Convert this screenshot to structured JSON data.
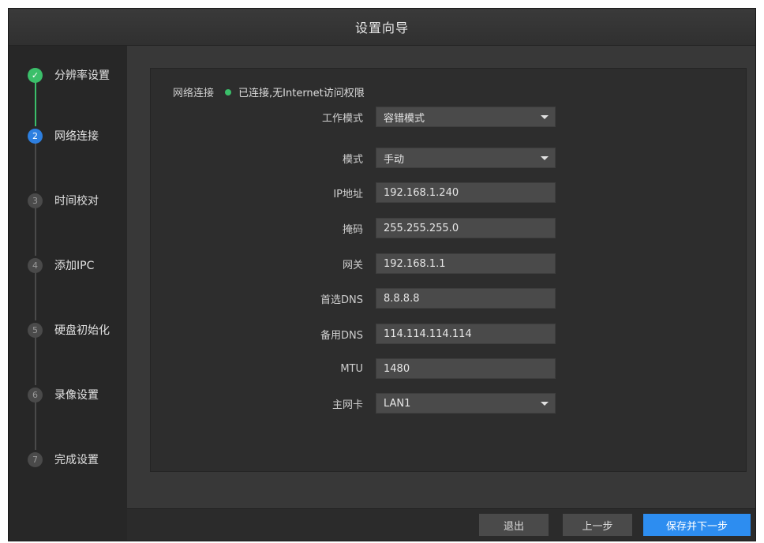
{
  "window": {
    "title": "设置向导"
  },
  "steps": [
    {
      "num": "✓",
      "label": "分辨率设置",
      "state": "done"
    },
    {
      "num": "2",
      "label": "网络连接",
      "state": "active"
    },
    {
      "num": "3",
      "label": "时间校对",
      "state": "pending"
    },
    {
      "num": "4",
      "label": "添加IPC",
      "state": "pending"
    },
    {
      "num": "5",
      "label": "硬盘初始化",
      "state": "pending"
    },
    {
      "num": "6",
      "label": "录像设置",
      "state": "pending"
    },
    {
      "num": "7",
      "label": "完成设置",
      "state": "pending"
    }
  ],
  "network": {
    "status_label": "网络连接",
    "status_value": "已连接,无Internet访问权限",
    "status_color": "#3bbf6a"
  },
  "form": {
    "work_mode": {
      "label": "工作模式",
      "value": "容错模式"
    },
    "mode": {
      "label": "模式",
      "value": "手动"
    },
    "ip": {
      "label": "IP地址",
      "value": "192.168.1.240"
    },
    "mask": {
      "label": "掩码",
      "value": "255.255.255.0"
    },
    "gateway": {
      "label": "网关",
      "value": "192.168.1.1"
    },
    "dns1": {
      "label": "首选DNS",
      "value": "8.8.8.8"
    },
    "dns2": {
      "label": "备用DNS",
      "value": "114.114.114.114"
    },
    "mtu": {
      "label": "MTU",
      "value": "1480"
    },
    "nic": {
      "label": "主网卡",
      "value": "LAN1"
    }
  },
  "footer": {
    "exit": "退出",
    "prev": "上一步",
    "save_next": "保存并下一步"
  },
  "colors": {
    "accent": "#2d8df0",
    "success": "#3bbf6a"
  }
}
